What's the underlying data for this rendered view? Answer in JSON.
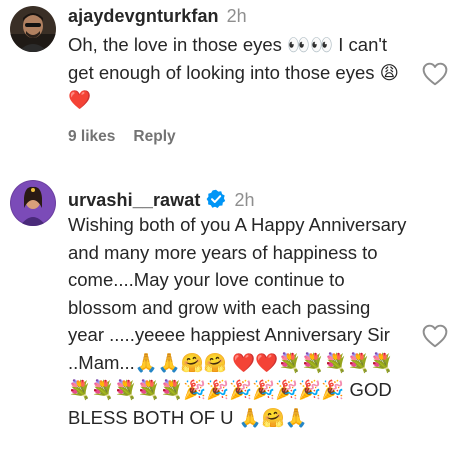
{
  "comments": [
    {
      "username": "ajaydevgnturkfan",
      "time": "2h",
      "verified": false,
      "text": "Oh, the love in those eyes 👀👀 I can't get enough of looking into those eyes 😩 ❤️",
      "likes": "9 likes",
      "reply_label": "Reply",
      "like_icon": "heart-outline-icon"
    },
    {
      "username": "urvashi__rawat",
      "time": "2h",
      "verified": true,
      "text": "Wishing both of you A Happy Anniversary and many more years of happiness to come....May your love continue to blossom and grow with each passing year .....yeeee happiest Anniversary Sir ..Mam...🙏🙏🤗🤗 ❤️❤️💐💐💐💐💐💐💐💐💐💐🎉🎉🎉🎉🎉🎉🎉 GOD BLESS BOTH OF U 🙏🤗🙏",
      "like_icon": "heart-outline-icon"
    }
  ],
  "colors": {
    "text": "#262626",
    "muted": "#8e8e8e",
    "verified": "#0095f6"
  }
}
